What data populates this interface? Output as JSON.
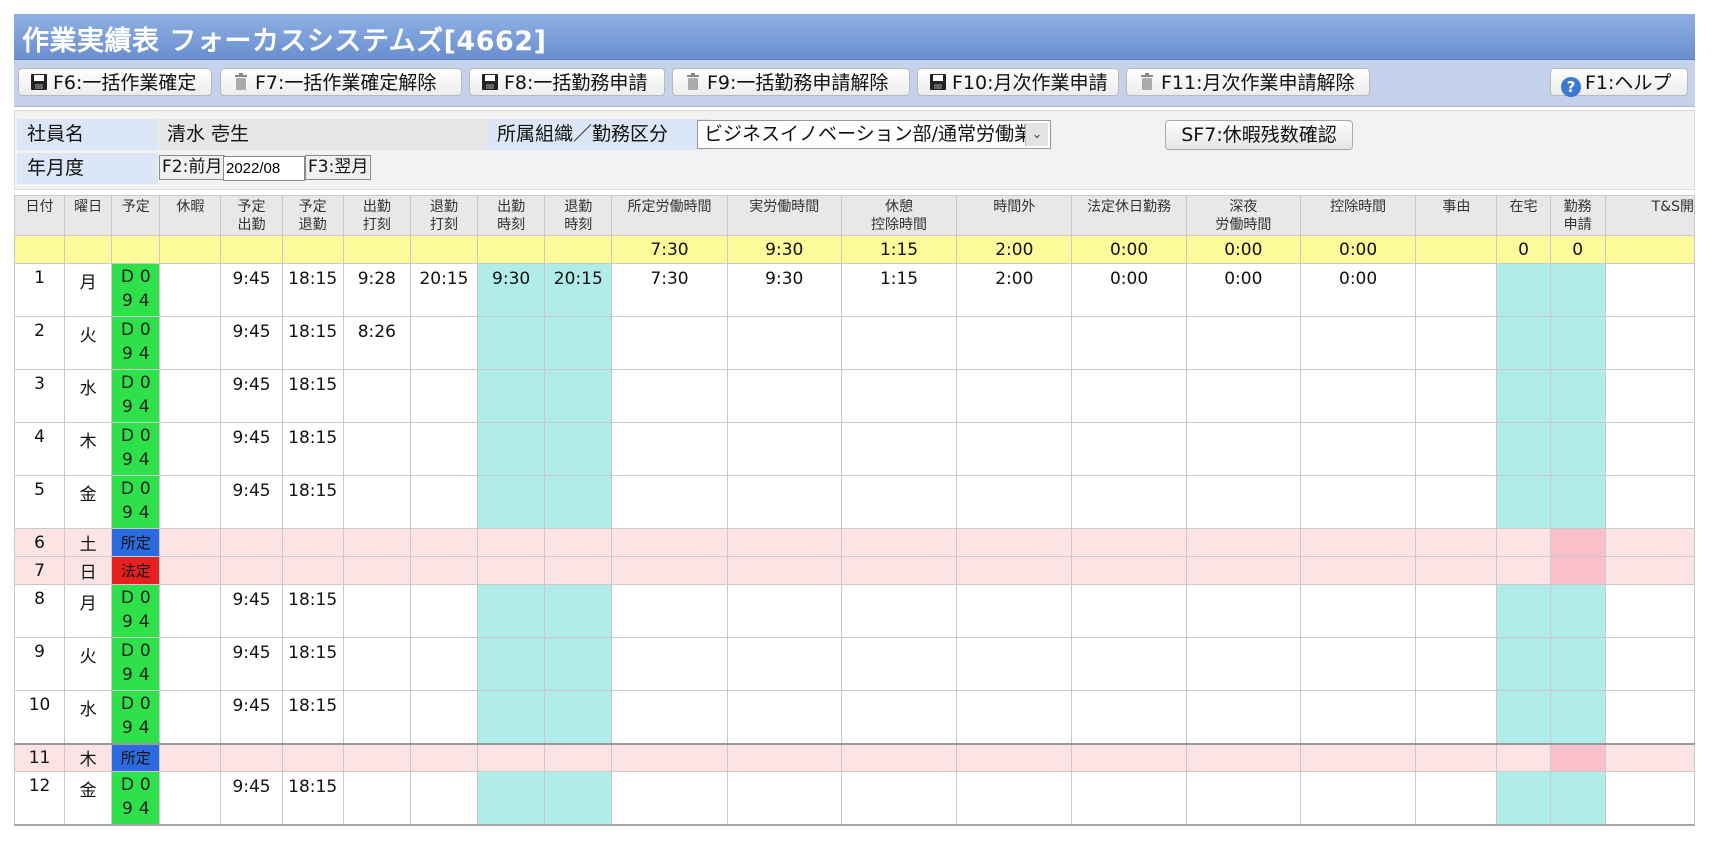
{
  "title": "作業実績表 フォーカスシステムズ[4662]",
  "toolbar": {
    "f6": "F6:一括作業確定",
    "f7": "F7:一括作業確定解除",
    "f8": "F8:一括勤務申請",
    "f9": "F9:一括勤務申請解除",
    "f10": "F10:月次作業申請",
    "f11": "F11:月次作業申請解除",
    "f1": "F1:ヘルプ"
  },
  "info": {
    "employee_label": "社員名",
    "employee_name": "清水 壱生",
    "org_label": "所属組織／勤務区分",
    "org_value": "ビジネスイノベーション部/通常労働業",
    "sf7": "SF7:休暇残数確認",
    "ym_label": "年月度",
    "prev": "F2:前月",
    "ym_value": "2022/08",
    "next": "F3:翌月"
  },
  "columns": [
    [
      "日付"
    ],
    [
      "曜日"
    ],
    [
      "予定"
    ],
    [
      "休暇"
    ],
    [
      "予定",
      "出勤"
    ],
    [
      "予定",
      "退勤"
    ],
    [
      "出勤",
      "打刻"
    ],
    [
      "退勤",
      "打刻"
    ],
    [
      "出勤",
      "時刻"
    ],
    [
      "退勤",
      "時刻"
    ],
    [
      "所定労働時間"
    ],
    [
      "実労働時間"
    ],
    [
      "休憩",
      "控除時間"
    ],
    [
      "時間外"
    ],
    [
      "法定休日勤務"
    ],
    [
      "深夜",
      "労働時間"
    ],
    [
      "控除時間"
    ],
    [
      "事由"
    ],
    [
      "在宅"
    ],
    [
      "勤務",
      "申請"
    ],
    [
      "T&S開"
    ]
  ],
  "summary": [
    "",
    "",
    "",
    "",
    "",
    "",
    "",
    "",
    "",
    "",
    "7:30",
    "9:30",
    "1:15",
    "2:00",
    "0:00",
    "0:00",
    "0:00",
    "",
    "0",
    "0",
    ""
  ],
  "rows": [
    {
      "d": "1",
      "w": "月",
      "s": "D094",
      "ps": "9:45",
      "pe": "18:15",
      "cs": "9:28",
      "ce": "20:15",
      "ts": "9:30",
      "te": "20:15",
      "sh": "7:30",
      "ah": "9:30",
      "br": "1:15",
      "ot": "2:00",
      "lh": "0:00",
      "nt": "0:00",
      "dd": "0:00"
    },
    {
      "d": "2",
      "w": "火",
      "s": "D094",
      "ps": "9:45",
      "pe": "18:15",
      "cs": "8:26"
    },
    {
      "d": "3",
      "w": "水",
      "s": "D094",
      "ps": "9:45",
      "pe": "18:15"
    },
    {
      "d": "4",
      "w": "木",
      "s": "D094",
      "ps": "9:45",
      "pe": "18:15"
    },
    {
      "d": "5",
      "w": "金",
      "s": "D094",
      "ps": "9:45",
      "pe": "18:15"
    },
    {
      "d": "6",
      "w": "土",
      "hol": "所定"
    },
    {
      "d": "7",
      "w": "日",
      "hol": "法定"
    },
    {
      "d": "8",
      "w": "月",
      "s": "D094",
      "ps": "9:45",
      "pe": "18:15"
    },
    {
      "d": "9",
      "w": "火",
      "s": "D094",
      "ps": "9:45",
      "pe": "18:15"
    },
    {
      "d": "10",
      "w": "水",
      "s": "D094",
      "ps": "9:45",
      "pe": "18:15"
    },
    {
      "d": "11",
      "w": "木",
      "hol": "所定"
    },
    {
      "d": "12",
      "w": "金",
      "s": "D094",
      "ps": "9:45",
      "pe": "18:15"
    }
  ],
  "colors": {
    "title_bg": "#6a8fcf",
    "schedule_green": "#2ee04a",
    "holiday_blue": "#2a6bdf",
    "holiday_red": "#e81f1f",
    "cyan": "#b0ecea",
    "summary_yellow": "#fdfa9a",
    "holiday_row": "#fde4e4"
  },
  "icons": {
    "save": "floppy-disk-icon",
    "delete": "trash-icon",
    "help": "question-circle-icon",
    "dropdown": "chevron-down-icon"
  }
}
